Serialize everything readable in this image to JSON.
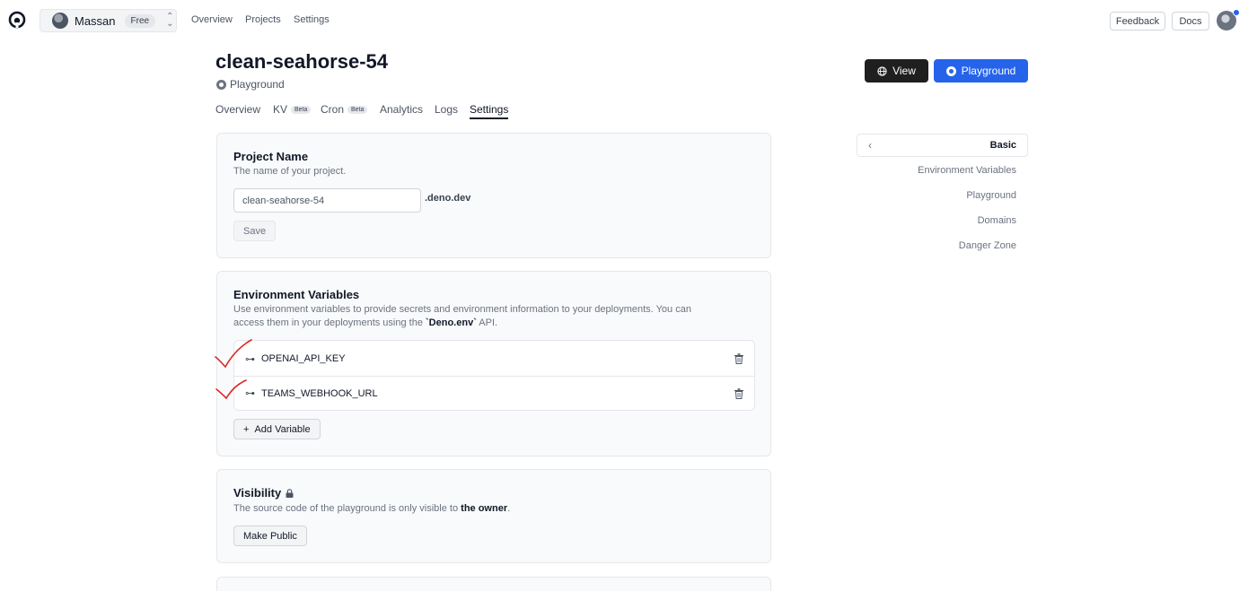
{
  "topnav": {
    "org_name": "Massan",
    "plan": "Free",
    "links": [
      "Overview",
      "Projects",
      "Settings"
    ],
    "feedback": "Feedback",
    "docs": "Docs"
  },
  "header": {
    "title": "clean-seahorse-54",
    "type": "Playground",
    "view_label": "View",
    "playground_label": "Playground"
  },
  "tabs": {
    "overview": "Overview",
    "kv": "KV",
    "kv_badge": "Beta",
    "cron": "Cron",
    "cron_badge": "Beta",
    "analytics": "Analytics",
    "logs": "Logs",
    "settings": "Settings"
  },
  "project_name": {
    "title": "Project Name",
    "description": "The name of your project.",
    "value": "clean-seahorse-54",
    "suffix": ".deno.dev",
    "save": "Save"
  },
  "env_vars": {
    "title": "Environment Variables",
    "desc_1": "Use environment variables to provide secrets and environment information to your deployments. You can",
    "desc_2_pre": "access them in your deployments using the ",
    "desc_code": "`Deno.env`",
    "desc_2_post": " API.",
    "vars": [
      "OPENAI_API_KEY",
      "TEAMS_WEBHOOK_URL"
    ],
    "add_label": "Add Variable"
  },
  "visibility": {
    "title": "Visibility",
    "desc_pre": "The source code of the playground is only visible to ",
    "desc_bold": "the owner",
    "desc_post": ".",
    "button": "Make Public"
  },
  "sidenav": {
    "active": "Basic",
    "items": [
      "Environment Variables",
      "Playground",
      "Domains",
      "Danger Zone"
    ]
  },
  "colors": {
    "primary": "#2563eb",
    "dark_button": "#1f1f1f",
    "annotation": "#dc2626"
  }
}
